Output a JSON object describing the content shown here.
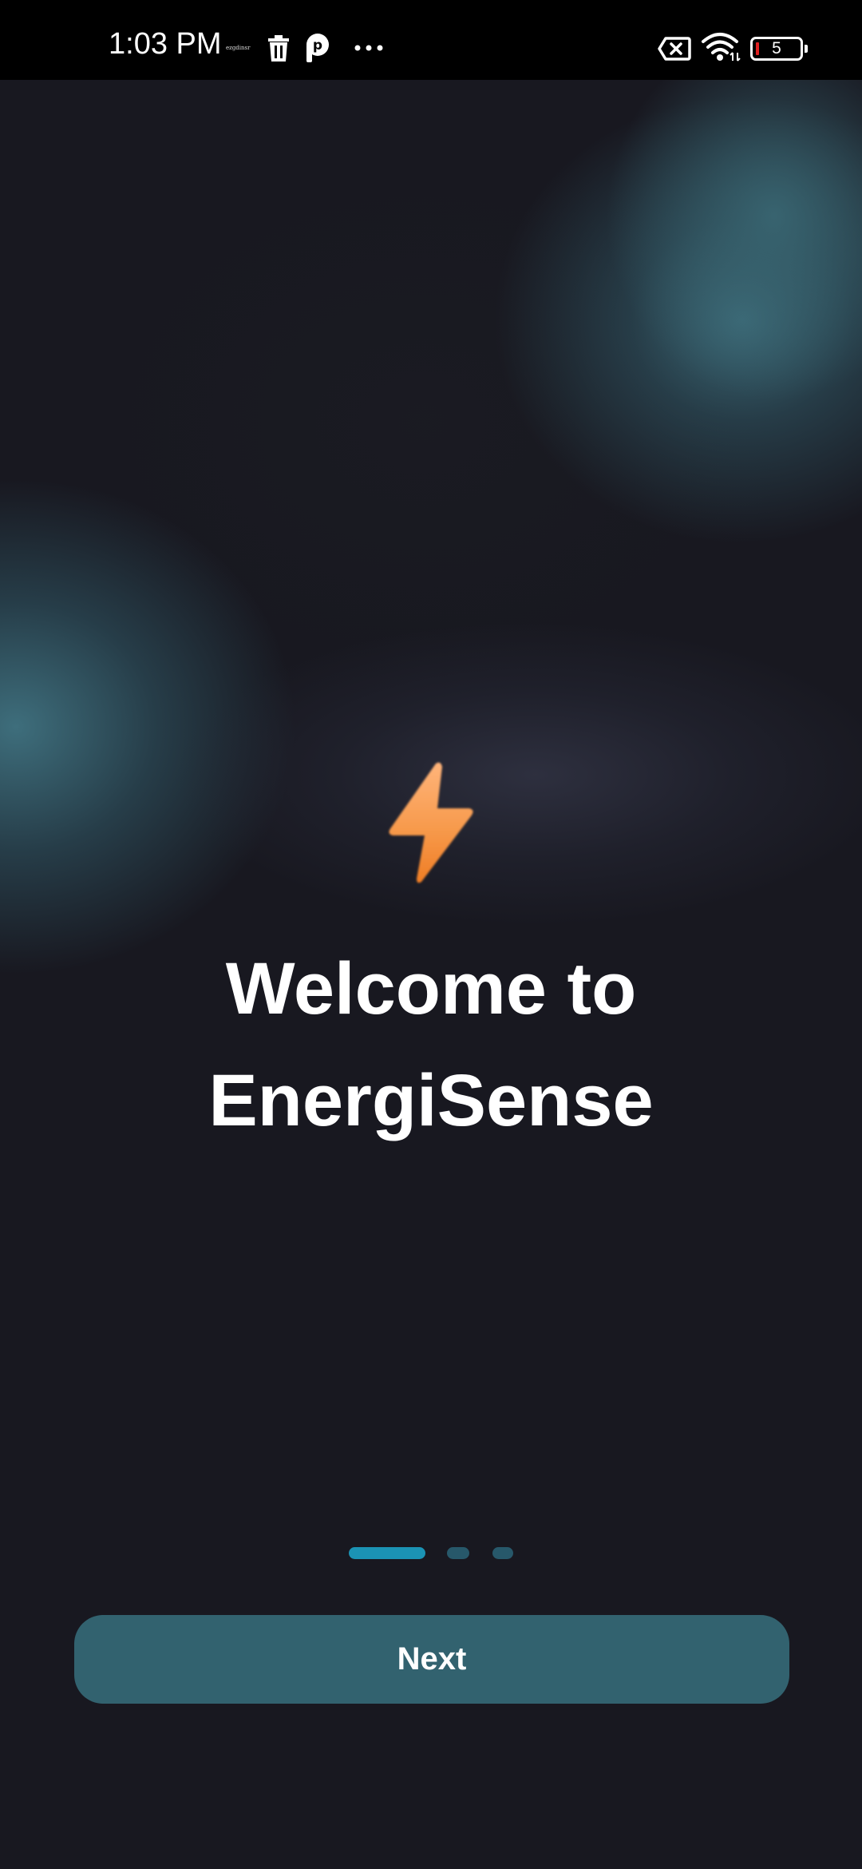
{
  "status_bar": {
    "time": "1:03 PM",
    "tiny_label": "ezgdinsr",
    "battery_level": "5",
    "icons": [
      "trash-icon",
      "p-icon",
      "more-dots-icon",
      "no-sim-icon",
      "wifi-icon",
      "battery-icon"
    ]
  },
  "onboarding": {
    "icon": "lightning-bolt-icon",
    "title_line1": "Welcome to",
    "title_line2": "EnergiSense",
    "pager": {
      "total_pages": 3,
      "current_page": 1
    },
    "next_label": "Next"
  },
  "colors": {
    "background": "#181820",
    "accent_glow": "#3e6e7c",
    "pager_active": "#1b93b4",
    "pager_inactive": "#27586a",
    "button": "#32626f",
    "bolt": "#f2913c"
  }
}
